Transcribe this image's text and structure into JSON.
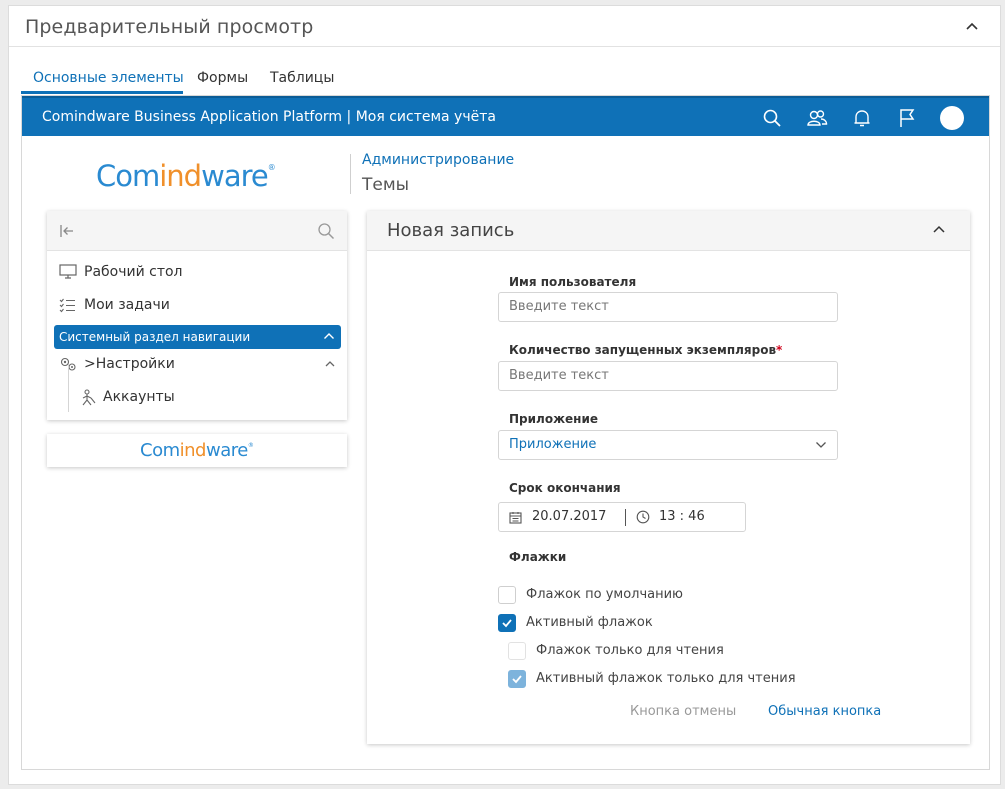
{
  "panel": {
    "title": "Предварительный просмотр"
  },
  "tabs": [
    {
      "label": "Основные элементы",
      "active": true
    },
    {
      "label": "Формы",
      "active": false
    },
    {
      "label": "Таблицы",
      "active": false
    }
  ],
  "topbar": {
    "title": "Comindware Business Application Platform  |  Моя система учёта",
    "icons": [
      "search-icon",
      "users-icon",
      "bell-icon",
      "flag-icon",
      "avatar"
    ]
  },
  "brand": {
    "logo_part1": "Com",
    "logo_part2": "ind",
    "logo_part3": "ware",
    "logo_mark": "®"
  },
  "breadcrumb": {
    "link": "Администрирование",
    "title": "Темы"
  },
  "nav": {
    "items": [
      {
        "label": "Рабочий стол",
        "icon": "monitor-icon"
      },
      {
        "label": "Мои задачи",
        "icon": "tasks-icon"
      }
    ],
    "section_label": "Системный раздел навигации",
    "group_label": ">Настройки",
    "sub_items": [
      {
        "label": "Аккаунты",
        "icon": "accounts-icon"
      }
    ]
  },
  "form": {
    "title": "Новая запись",
    "fields": {
      "username": {
        "label": "Имя пользователя",
        "placeholder": "Введите текст"
      },
      "instances": {
        "label": "Количество запущенных экземпляров",
        "required_mark": "*",
        "placeholder": "Введите текст"
      },
      "application": {
        "label": "Приложение",
        "value": "Приложение"
      },
      "deadline": {
        "label": "Срок окончания",
        "date": "20.07.2017",
        "time": "13 : 46"
      }
    },
    "checkboxes_label": "Флажки",
    "checkboxes": [
      {
        "label": "Флажок по умолчанию",
        "checked": false,
        "readonly": false
      },
      {
        "label": "Активный флажок",
        "checked": true,
        "readonly": false
      },
      {
        "label": "Флажок только для чтения",
        "checked": false,
        "readonly": true
      },
      {
        "label": "Активный флажок только для чтения",
        "checked": true,
        "readonly": true
      }
    ],
    "cancel_label": "Кнопка отмены",
    "normal_label": "Обычная кнопка"
  },
  "colors": {
    "accent": "#0f71b7",
    "logo_blue": "#2a8ad1",
    "logo_orange": "#f0902b",
    "required": "#d0021b"
  }
}
